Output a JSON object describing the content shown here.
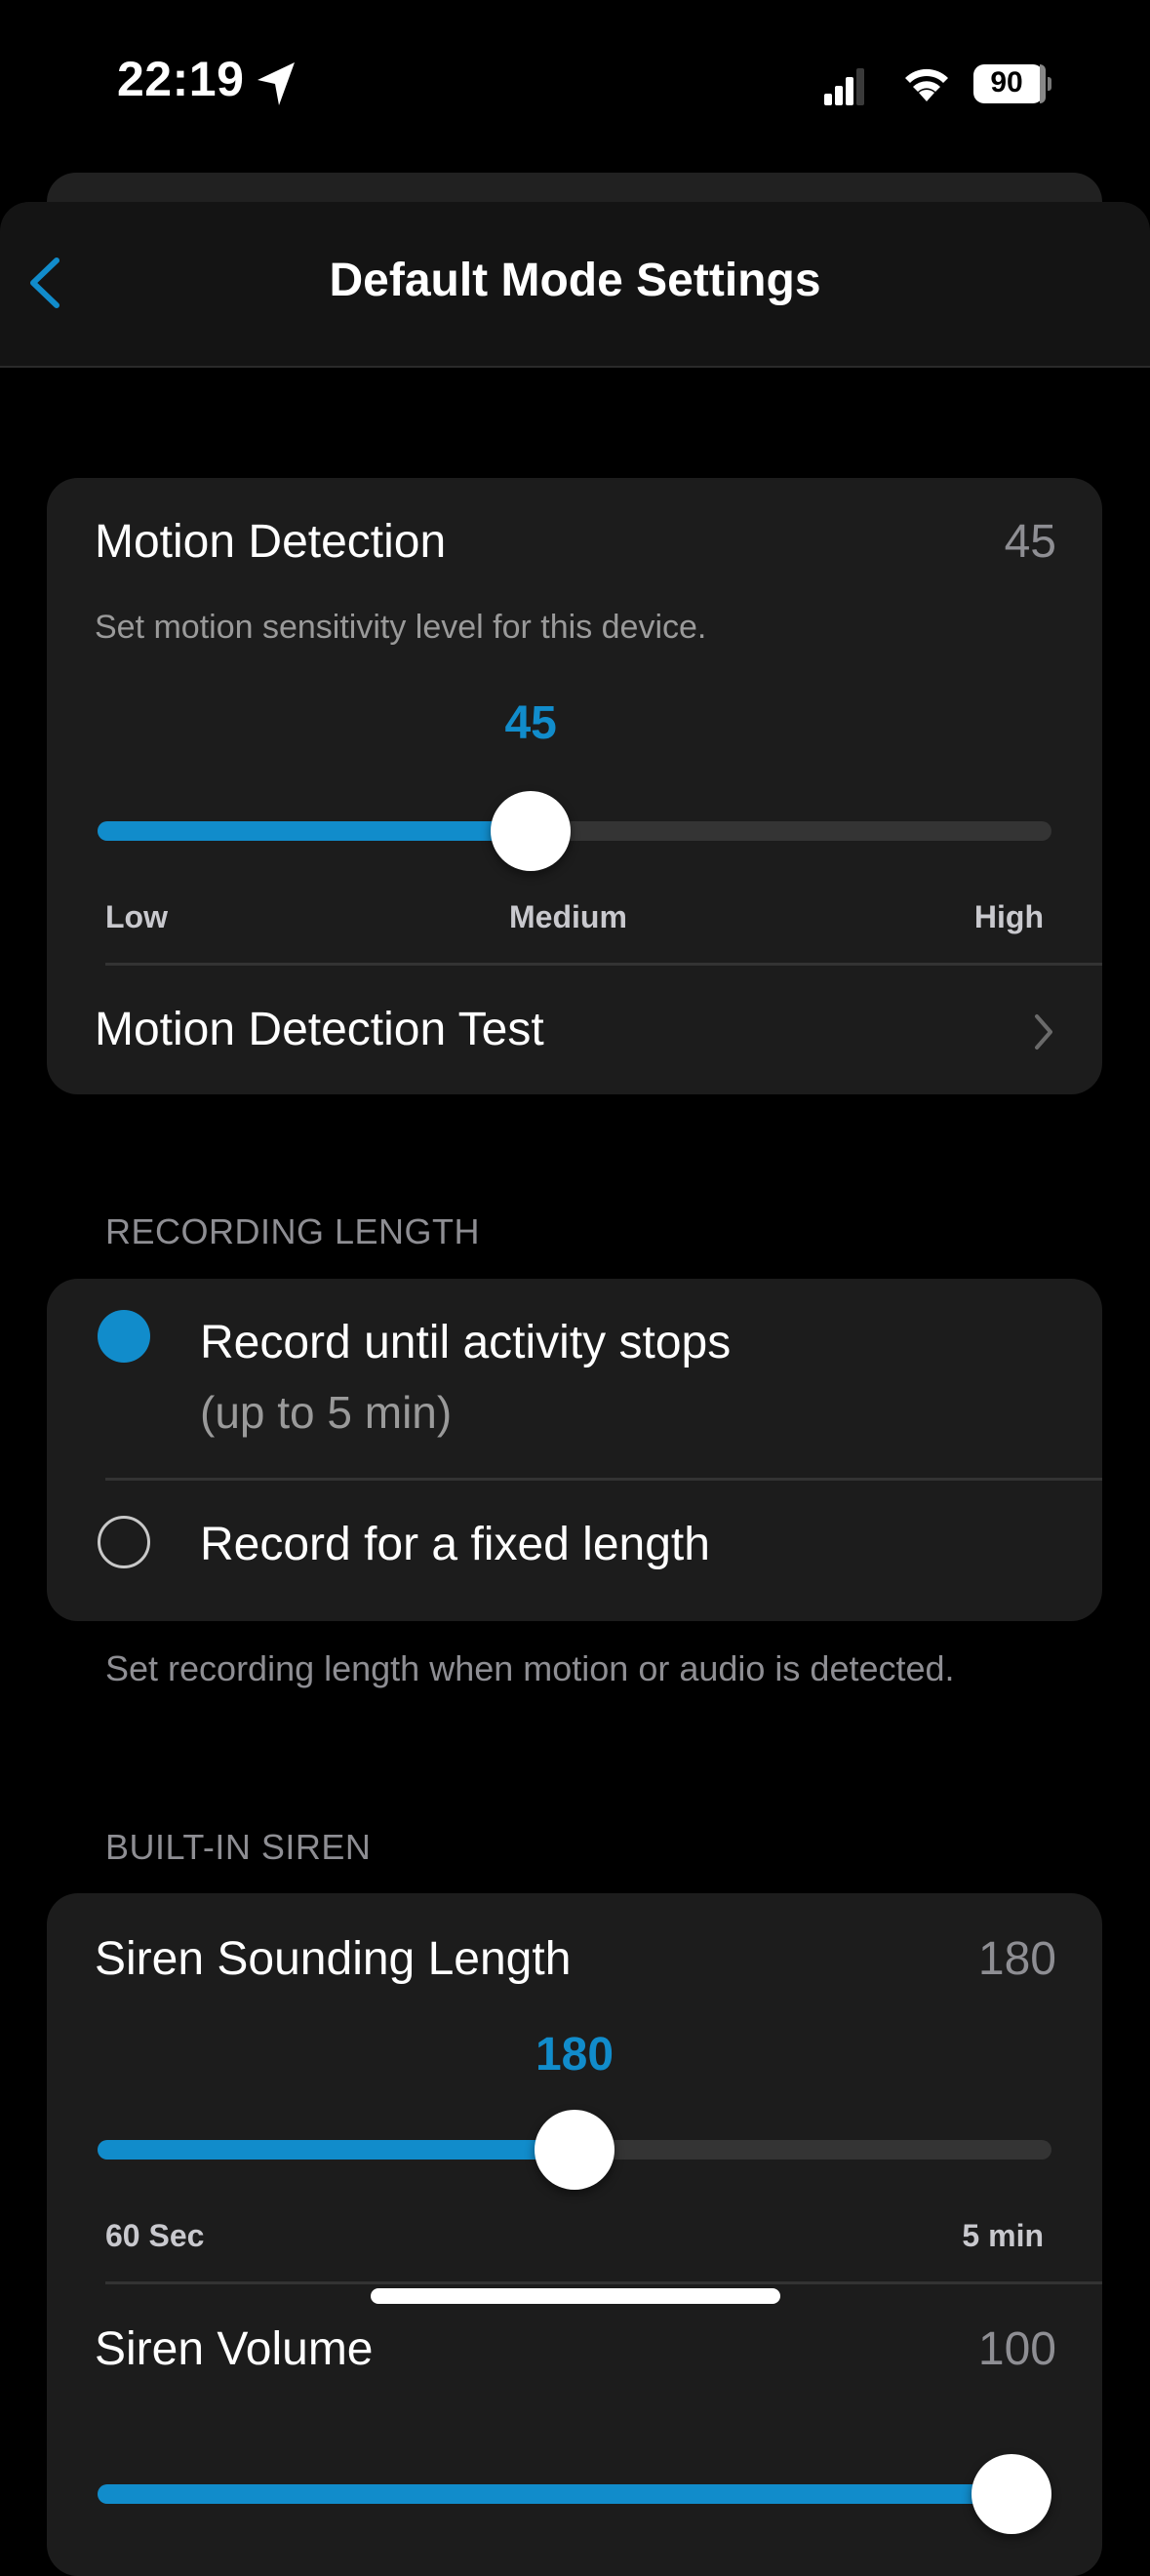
{
  "status_bar": {
    "time": "22:19",
    "location_icon": "location-arrow-icon",
    "signal_icon": "cellular-signal-icon",
    "wifi_icon": "wifi-icon",
    "battery_level": "90"
  },
  "nav": {
    "back_icon": "chevron-left-icon",
    "title": "Default Mode Settings"
  },
  "motion_detection": {
    "title": "Motion Detection",
    "value": "45",
    "description": "Set motion sensitivity level for this device.",
    "slider": {
      "current_label": "45",
      "value": 45,
      "min": 0,
      "max": 100,
      "tick_labels": [
        "Low",
        "Medium",
        "High"
      ]
    },
    "test_row": {
      "label": "Motion Detection Test",
      "chevron_icon": "chevron-right-icon"
    }
  },
  "recording_length": {
    "header": "RECORDING LENGTH",
    "options": [
      {
        "label": "Record until activity stops",
        "sublabel": "(up to 5 min)",
        "selected": true
      },
      {
        "label": "Record for a fixed length",
        "selected": false
      }
    ],
    "footer": "Set recording length when motion or audio is detected."
  },
  "built_in_siren": {
    "header": "BUILT-IN SIREN",
    "sounding_length": {
      "title": "Siren Sounding Length",
      "value": "180",
      "slider": {
        "current_label": "180",
        "value": 180,
        "min": 60,
        "max": 300,
        "min_label": "60 Sec",
        "max_label": "5 min"
      }
    },
    "volume": {
      "title": "Siren Volume",
      "value": "100",
      "slider": {
        "value": 100,
        "min": 0,
        "max": 100
      }
    }
  },
  "colors": {
    "accent": "#118ccb",
    "background": "#000000",
    "card": "#1c1c1c",
    "secondary_text": "#8e8e93"
  }
}
